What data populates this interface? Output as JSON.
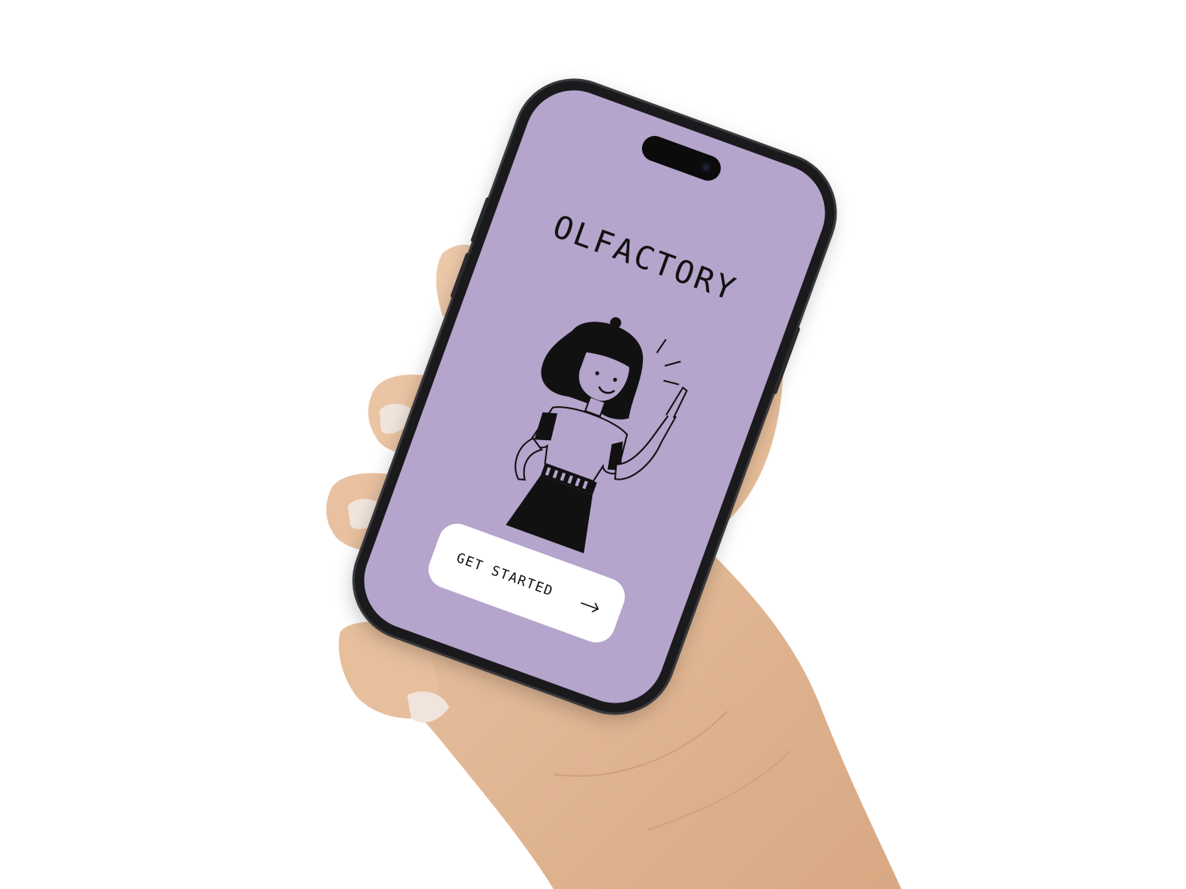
{
  "app": {
    "title": "OLFACTORY"
  },
  "illustration": {
    "subject": "woman-pointing-up-illustration"
  },
  "cta": {
    "label": "GET STARTED",
    "icon": "arrow-right-icon"
  },
  "colors": {
    "screen_background": "#b5a4cc",
    "button_background": "#ffffff",
    "text": "#111111",
    "phone_frame": "#1a1a1c",
    "skin": "#e3b995"
  }
}
